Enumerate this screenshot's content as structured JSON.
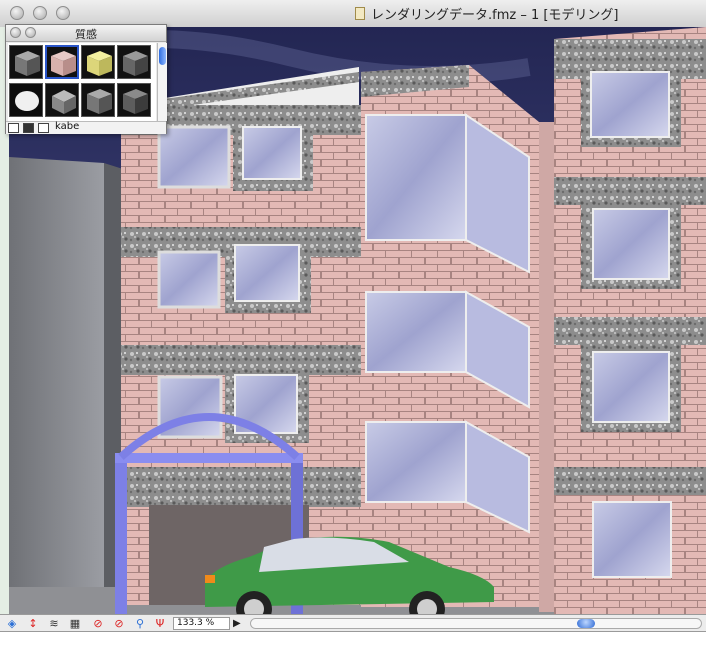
{
  "window": {
    "title": "レンダリングデータ.fmz – 1 [モデリング]"
  },
  "palette": {
    "title": "質感",
    "selected_material": "kabe",
    "swatch_icons": [
      "gray-cube-icon",
      "brick-cube-icon",
      "yellow-cube-icon",
      "dark-cube-icon",
      "white-blob-icon",
      "metal-sphere-icon",
      "gray-cube-icon",
      "dark-cube-icon"
    ]
  },
  "toolbar": {
    "zoom": "133.3 %",
    "tool_icons": [
      "layer-icon",
      "move-vertical-icon",
      "wave-icon",
      "grid-icon",
      "no-entry-icon",
      "no-entry-icon",
      "magnifier-icon",
      "fork-icon"
    ]
  },
  "colors": {
    "sky": "#3a3f74",
    "brick": "#e3b9b5",
    "stone": "#8a8a8a",
    "arch": "#7d80e6",
    "car": "#3f9a48",
    "accent": "#2f6de0"
  }
}
